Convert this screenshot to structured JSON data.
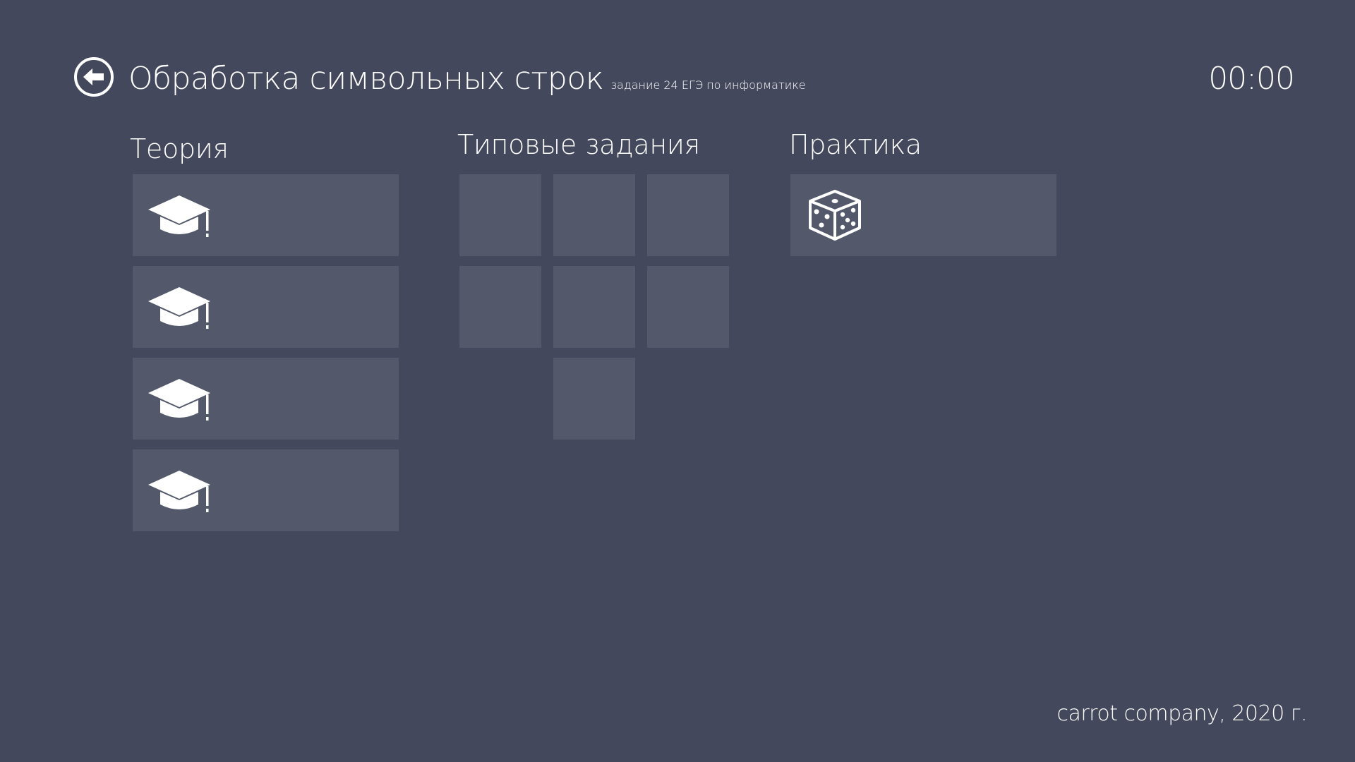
{
  "header": {
    "title": "Обработка символьных строк",
    "subtitle": "задание 24 ЕГЭ по информатике",
    "timer": "00:00",
    "back_icon": "back-arrow-icon"
  },
  "sections": {
    "theory": {
      "heading": "Теория",
      "tiles": [
        {
          "icon": "graduation-cap-icon"
        },
        {
          "icon": "graduation-cap-icon"
        },
        {
          "icon": "graduation-cap-icon"
        },
        {
          "icon": "graduation-cap-icon"
        }
      ]
    },
    "typical_tasks": {
      "heading": "Типовые задания",
      "tile_count": 7
    },
    "practice": {
      "heading": "Практика",
      "tiles": [
        {
          "icon": "dice-icon"
        }
      ]
    }
  },
  "footer": {
    "text": "carrot company, 2020 г."
  },
  "colors": {
    "background": "#44485c",
    "tile": "#53586b",
    "text": "#ffffff"
  }
}
